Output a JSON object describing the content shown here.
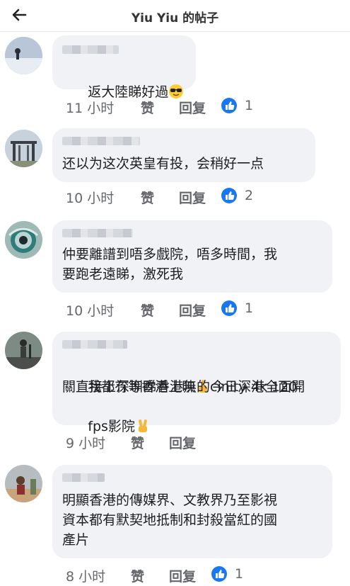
{
  "header": {
    "title": "Yiu Yiu 的帖子"
  },
  "comments": [
    {
      "text": "返大陸睇好過",
      "time": "11 小时",
      "like": "赞",
      "reply": "回复",
      "reactions": "1"
    },
    {
      "text": "还以为这次英皇有投，会稍好一点",
      "time": "10 小时",
      "like": "赞",
      "reply": "回复",
      "reactions": "2"
    },
    {
      "line1": "仲要離譜到唔多戲院，唔多時間，我",
      "line2": "要跑老遠睇，激死我",
      "time": "10 小时",
      "like": "赞",
      "reply": "回复",
      "reactions": "1"
    },
    {
      "line1a": "我都冇等香港上映",
      "line1b": "今日深港全面開",
      "line2": "關直接上深圳睇香港無的cinity 4k 120",
      "line3": "fps影院",
      "time": "9 小时",
      "like": "赞",
      "reply": "回复"
    },
    {
      "line1": "明顯香港的傳媒界、文教界乃至影視",
      "line2": "資本都有默契地抵制和封殺當紅的國",
      "line3": "產片",
      "time": "8 小时",
      "like": "赞",
      "reply": "回复",
      "reactions": "1"
    }
  ],
  "icons": {
    "back": "arrow-left-icon",
    "like_badge": "thumbs-up-icon",
    "brand": "#1877f2"
  }
}
